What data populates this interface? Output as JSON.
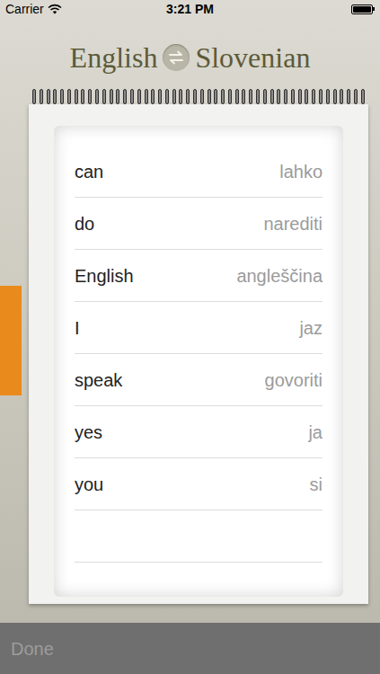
{
  "status_bar": {
    "carrier": "Carrier",
    "time": "3:21 PM"
  },
  "header": {
    "source_language": "English",
    "target_language": "Slovenian"
  },
  "words": [
    {
      "english": "can",
      "slovenian": "lahko"
    },
    {
      "english": "do",
      "slovenian": "narediti"
    },
    {
      "english": "English",
      "slovenian": "angleščina"
    },
    {
      "english": "I",
      "slovenian": "jaz"
    },
    {
      "english": "speak",
      "slovenian": "govoriti"
    },
    {
      "english": "yes",
      "slovenian": "ja"
    },
    {
      "english": "you",
      "slovenian": "si"
    }
  ],
  "toolbar": {
    "button": "Done",
    "disabled": true
  }
}
